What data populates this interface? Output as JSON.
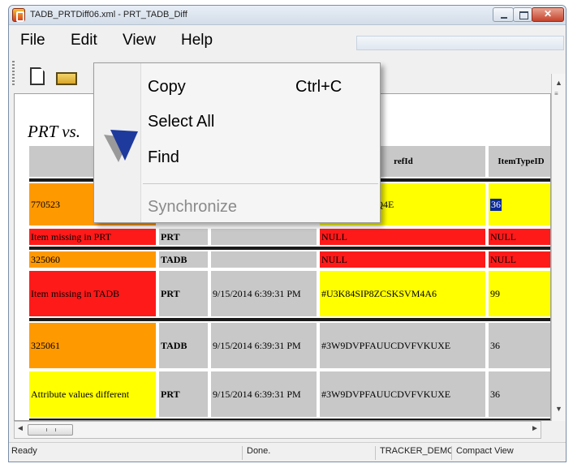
{
  "window": {
    "title": "TADB_PRTDiff06.xml - PRT_TADB_Diff"
  },
  "menu": {
    "file": "File",
    "edit": "Edit",
    "view": "View",
    "help": "Help"
  },
  "toolbar": {
    "new_icon": "new-document-icon",
    "open_icon": "open-folder-icon"
  },
  "document": {
    "title": "PRT vs."
  },
  "table": {
    "headers": {
      "refId": "refId",
      "itemTypeId": "ItemTypeID"
    },
    "rows": [
      {
        "id": "770523",
        "refId": "DZQRJ4VCLQ4E",
        "itemTypeId": "36"
      },
      {
        "status": "Item missing in PRT",
        "source": "PRT",
        "refId": "NULL",
        "itemTypeId": "NULL"
      },
      {
        "id": "325060",
        "source": "TADB",
        "refId": "NULL",
        "itemTypeId": "NULL"
      },
      {
        "status": "Item missing in TADB",
        "source": "PRT",
        "date": "9/15/2014 6:39:31 PM",
        "refId": "#U3K84SIP8ZCSKSVM4A6",
        "itemTypeId": "99"
      },
      {
        "id": "325061",
        "source": "TADB",
        "date": "9/15/2014 6:39:31 PM",
        "refId": "#3W9DVPFAUUCDVFVKUXE",
        "itemTypeId": "36"
      },
      {
        "status": "Attribute values different",
        "source": "PRT",
        "date": "9/15/2014 6:39:31 PM",
        "refId": "#3W9DVPFAUUCDVFVKUXE",
        "itemTypeId": "36"
      }
    ]
  },
  "edit_menu": {
    "copy": "Copy",
    "copy_shortcut": "Ctrl+C",
    "select_all": "Select All",
    "find": "Find",
    "synchronize": "Synchronize"
  },
  "status": {
    "ready": "Ready",
    "done": "Done.",
    "tracker": "TRACKER_DEMO",
    "view": "Compact View"
  },
  "colors": {
    "missing": "#ff1a1a",
    "id_cell": "#ff9900",
    "changed": "#ffff00",
    "neutral": "#c8c8c8"
  }
}
